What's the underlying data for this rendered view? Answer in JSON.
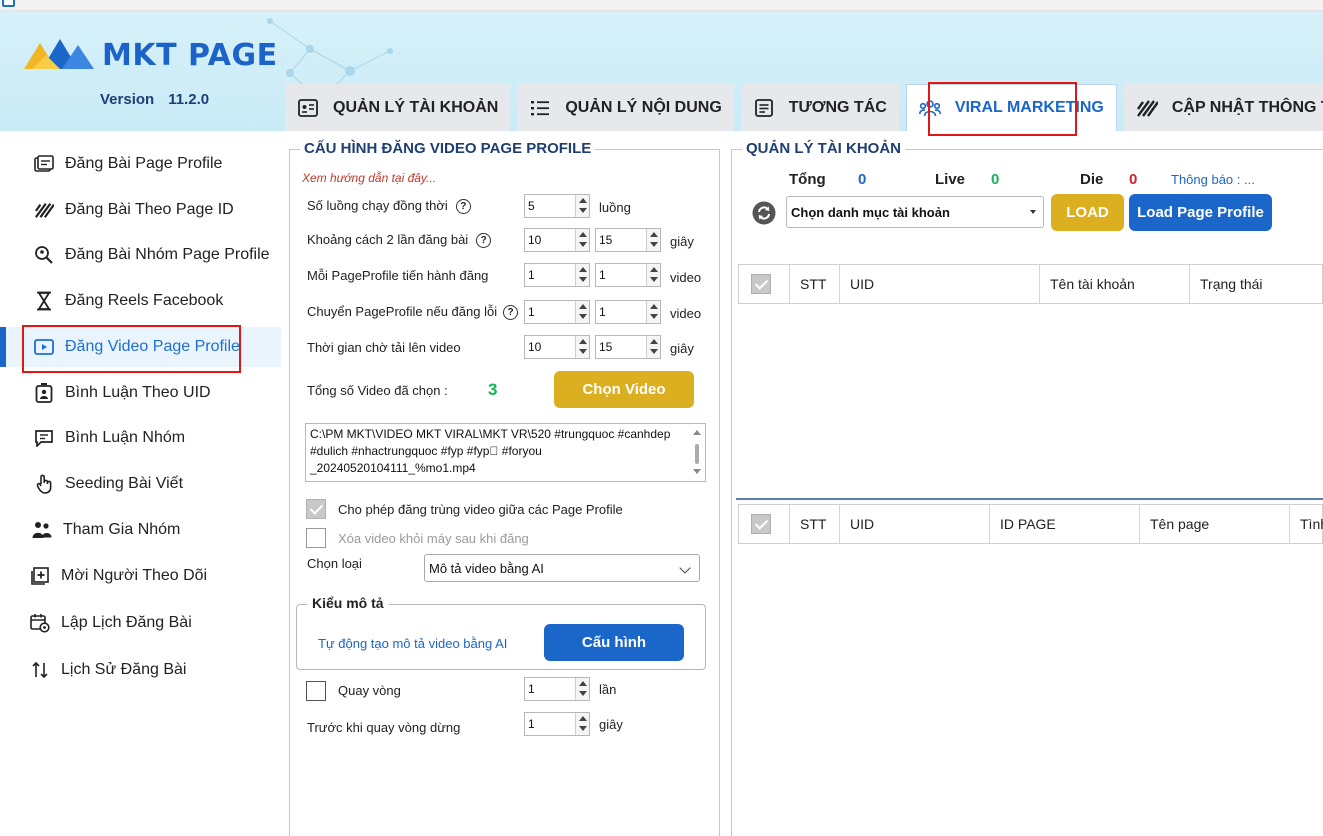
{
  "app": {
    "logo_text": "MKT PAGE",
    "version_label": "Version",
    "version_number": "11.2.0"
  },
  "tabs": [
    {
      "label": "QUẢN LÝ TÀI KHOẢN",
      "icon": "account-card-icon"
    },
    {
      "label": "QUẢN LÝ NỘI DUNG",
      "icon": "list-icon"
    },
    {
      "label": "TƯƠNG TÁC",
      "icon": "document-lines-icon"
    },
    {
      "label": "VIRAL MARKETING",
      "icon": "people-group-icon",
      "active": true
    },
    {
      "label": "CẬP NHẬT THÔNG TIN",
      "icon": "signal-stripes-icon"
    }
  ],
  "sidebar": {
    "items": [
      {
        "label": "Đăng Bài Page Profile",
        "icon": "post-page-icon"
      },
      {
        "label": "Đăng Bài Theo Page ID",
        "icon": "signal-stripes-icon"
      },
      {
        "label": "Đăng Bài Nhóm Page Profile",
        "icon": "search-group-icon"
      },
      {
        "label": "Đăng Reels Facebook",
        "icon": "hourglass-icon"
      },
      {
        "label": "Đăng Video Page Profile",
        "icon": "video-icon",
        "active": true
      },
      {
        "label": "Bình Luận Theo UID",
        "icon": "id-badge-icon"
      },
      {
        "label": "Bình Luận Nhóm",
        "icon": "comment-icon"
      },
      {
        "label": "Seeding Bài Viết",
        "icon": "hand-pointer-icon"
      },
      {
        "label": "Tham Gia Nhóm",
        "icon": "people-icon"
      },
      {
        "label": "Mời Người Theo Dõi",
        "icon": "add-square-icon"
      },
      {
        "label": "Lập Lịch Đăng Bài",
        "icon": "calendar-gear-icon"
      },
      {
        "label": "Lịch Sử Đăng Bài",
        "icon": "sort-arrows-icon"
      }
    ]
  },
  "config": {
    "title": "CẤU HÌNH ĐĂNG VIDEO PAGE PROFILE",
    "guide_link": "Xem hướng dẫn tại đây...",
    "threads_label": "Số luồng chạy đồng thời",
    "threads_value": "5",
    "threads_unit": "luồng",
    "delay_label": "Khoảng cách 2 lần đăng bài",
    "delay_from": "10",
    "delay_to": "15",
    "delay_unit": "giây",
    "per_profile_label": "Mỗi PageProfile tiến hành đăng",
    "per_profile_from": "1",
    "per_profile_to": "1",
    "per_profile_unit": "video",
    "switch_label": "Chuyển PageProfile nếu đăng lỗi",
    "switch_from": "1",
    "switch_to": "1",
    "switch_unit": "video",
    "upload_wait_label": "Thời gian chờ tải lên video",
    "upload_wait_from": "10",
    "upload_wait_to": "15",
    "upload_wait_unit": "giây",
    "total_video_label": "Tổng số Video đã chọn :",
    "total_video_count": "3",
    "choose_video_button": "Chọn Video",
    "video_paths": "C:\\PM MKT\\VIDEO MKT VIRAL\\MKT VR\\520 #trungquoc #canhdep #dulich #nhactrungquoc #fyp #fyp゚ #foryou _20240520104111_%mo1.mp4",
    "allow_duplicate_label": "Cho phép đăng trùng video giữa các Page Profile",
    "allow_duplicate_checked": true,
    "delete_after_label": "Xóa video khỏi máy sau khi đăng",
    "delete_after_checked": false,
    "type_label": "Chọn loại",
    "type_value": "Mô tả video bằng AI",
    "desc_group_title": "Kiểu mô tả",
    "desc_auto_label": "Tự động tạo mô tả video bằng AI",
    "desc_config_button": "Cấu hình",
    "loop_label": "Quay vòng",
    "loop_value": "1",
    "loop_unit": "lần",
    "loop_checked": false,
    "before_stop_label": "Trước khi quay vòng dừng",
    "before_stop_value": "1",
    "before_stop_unit": "giây"
  },
  "accounts": {
    "title": "QUẢN LÝ TÀI KHOẢN",
    "total_label": "Tổng",
    "total_value": "0",
    "live_label": "Live",
    "live_value": "0",
    "die_label": "Die",
    "die_value": "0",
    "notice_label": "Thông báo : ...",
    "category_placeholder": "Chọn danh mục tài khoản",
    "load_button": "LOAD",
    "load_page_profile_button": "Load Page Profile",
    "table1_headers": [
      "STT",
      "UID",
      "Tên tài khoản",
      "Trạng thái"
    ],
    "table2_headers": [
      "STT",
      "UID",
      "ID PAGE",
      "Tên page",
      "Tình"
    ]
  },
  "colors": {
    "brand_blue": "#1b66c9",
    "accent_yellow": "#dcaf21",
    "live_green": "#19b15a",
    "die_red": "#d3202f",
    "highlight_red": "#e11717"
  }
}
